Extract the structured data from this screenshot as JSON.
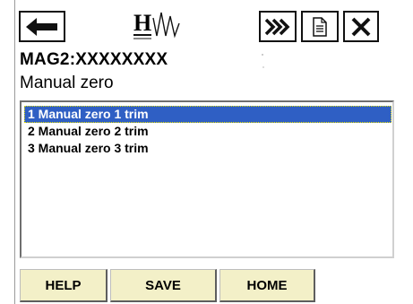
{
  "toolbar": {
    "back_icon": "arrow-left-icon",
    "logo_icon": "hart-logo-icon",
    "logo_text": "H",
    "forward_icon": "fast-forward-icon",
    "document_icon": "document-icon",
    "close_icon": "close-icon"
  },
  "device": {
    "tag": "MAG2:XXXXXXXX"
  },
  "menu": {
    "title": "Manual zero",
    "items": [
      {
        "label": "1 Manual zero 1 trim",
        "selected": true
      },
      {
        "label": "2 Manual zero 2 trim",
        "selected": false
      },
      {
        "label": "3 Manual zero 3 trim",
        "selected": false
      }
    ]
  },
  "buttons": {
    "help": "HELP",
    "save": "SAVE",
    "home": "HOME"
  },
  "colors": {
    "selection": "#2f5fc4",
    "button_face": "#f3f0c8",
    "selection_text": "#ffffff"
  }
}
